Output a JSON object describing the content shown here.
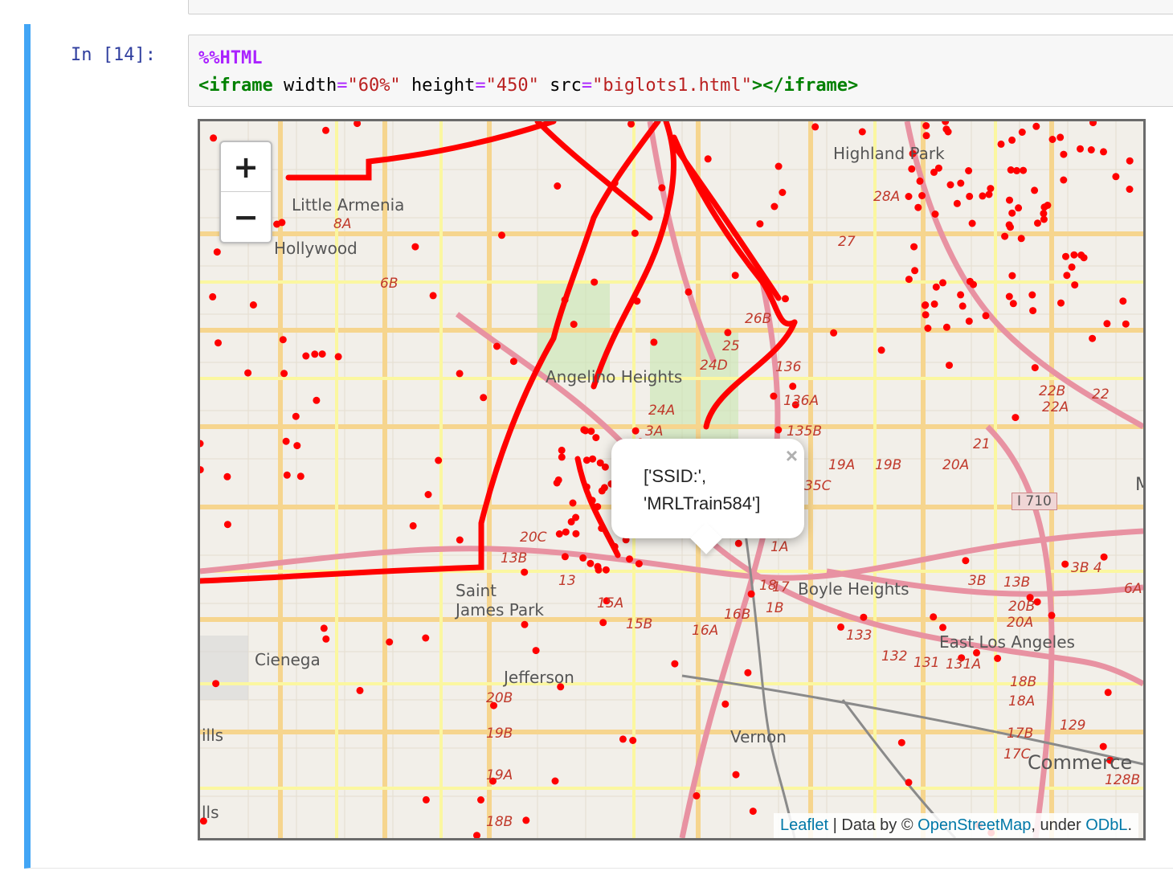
{
  "cell": {
    "prompt": "In [14]:",
    "code_line1_magic": "%%HTML",
    "code_iframe_open": "<iframe",
    "code_attr_width": "width",
    "code_val_width": "\"60%\"",
    "code_attr_height": "height",
    "code_val_height": "\"450\"",
    "code_attr_src": "src",
    "code_val_src": "\"biglots1.html\"",
    "code_iframe_close": "></iframe>"
  },
  "map": {
    "zoom_in": "+",
    "zoom_out": "−",
    "popup_text": "['SSID:',\n'MRLTrain584']",
    "popup_close": "×",
    "attribution_leaflet": "Leaflet",
    "attribution_middle": " | Data by © ",
    "attribution_osm": "OpenStreetMap",
    "attribution_under": ", under ",
    "attribution_odbl": "ODbL",
    "attribution_end": ".",
    "labels": [
      "Highland Park",
      "Little Armenia",
      "Hollywood",
      "Angelino Heights",
      "Boyle Heights",
      "East Los Angeles",
      "Saint James Park",
      "Cienega",
      "Jefferson",
      "Vernon",
      "Commerce",
      "ills",
      "lls",
      "M"
    ],
    "shields": [
      "6B",
      "8A",
      "28A",
      "27",
      "26B",
      "25",
      "24D",
      "136",
      "136A",
      "135B",
      "19A",
      "19B",
      "20A",
      "21",
      "22B",
      "22A",
      "22",
      "3A",
      "24A",
      "20C",
      "13B",
      "13",
      "15A",
      "15B",
      "16A",
      "16B",
      "18",
      "1B",
      "17",
      "1A",
      "133",
      "132",
      "131",
      "131A",
      "18B",
      "18A",
      "17B",
      "17C",
      "129",
      "128B",
      "20B",
      "19B",
      "19A",
      "18B",
      "3B",
      "3B 4",
      "6A",
      "20B",
      "20A",
      "I 710",
      "35C",
      "13B"
    ],
    "marker_color": "#ff0000"
  }
}
